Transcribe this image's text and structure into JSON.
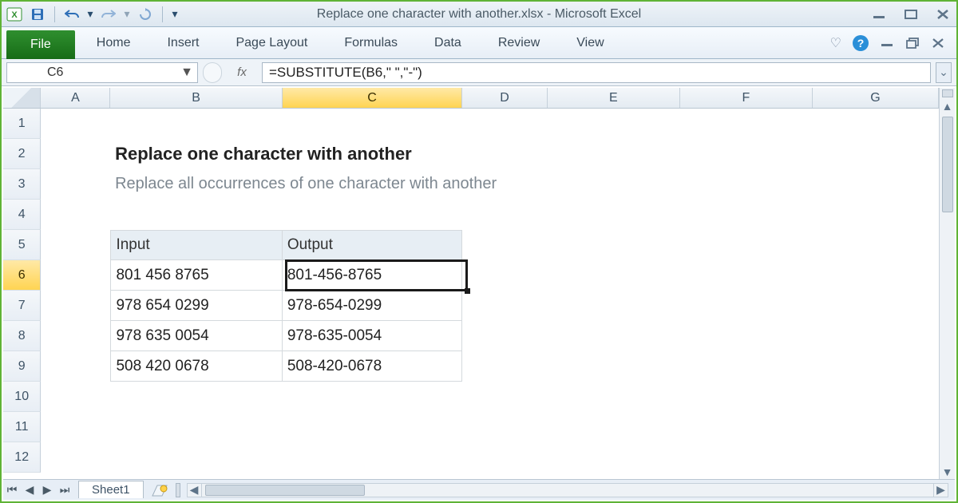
{
  "window": {
    "title": "Replace one character with another.xlsx  -  Microsoft Excel"
  },
  "qat": {
    "save": "save-icon",
    "undo": "undo-icon",
    "redo": "redo-icon",
    "refresh": "refresh-icon"
  },
  "ribbon": {
    "file": "File",
    "tabs": [
      "Home",
      "Insert",
      "Page Layout",
      "Formulas",
      "Data",
      "Review",
      "View"
    ]
  },
  "formula_bar": {
    "name_box": "C6",
    "fx_label": "fx",
    "formula": "=SUBSTITUTE(B6,\" \",\"-\")"
  },
  "columns": [
    "A",
    "B",
    "C",
    "D",
    "E",
    "F",
    "G"
  ],
  "selected_column": "C",
  "rows": [
    "1",
    "2",
    "3",
    "4",
    "5",
    "6",
    "7",
    "8",
    "9",
    "10",
    "11",
    "12"
  ],
  "selected_row": "6",
  "content": {
    "title": "Replace one character with another",
    "subtitle": "Replace all occurrences of one character with another",
    "headers": {
      "input": "Input",
      "output": "Output"
    },
    "data": [
      {
        "input": "801 456 8765",
        "output": "801-456-8765"
      },
      {
        "input": "978 654 0299",
        "output": "978-654-0299"
      },
      {
        "input": "978 635 0054",
        "output": "978-635-0054"
      },
      {
        "input": "508 420 0678",
        "output": "508-420-0678"
      }
    ]
  },
  "sheet": {
    "name": "Sheet1"
  }
}
